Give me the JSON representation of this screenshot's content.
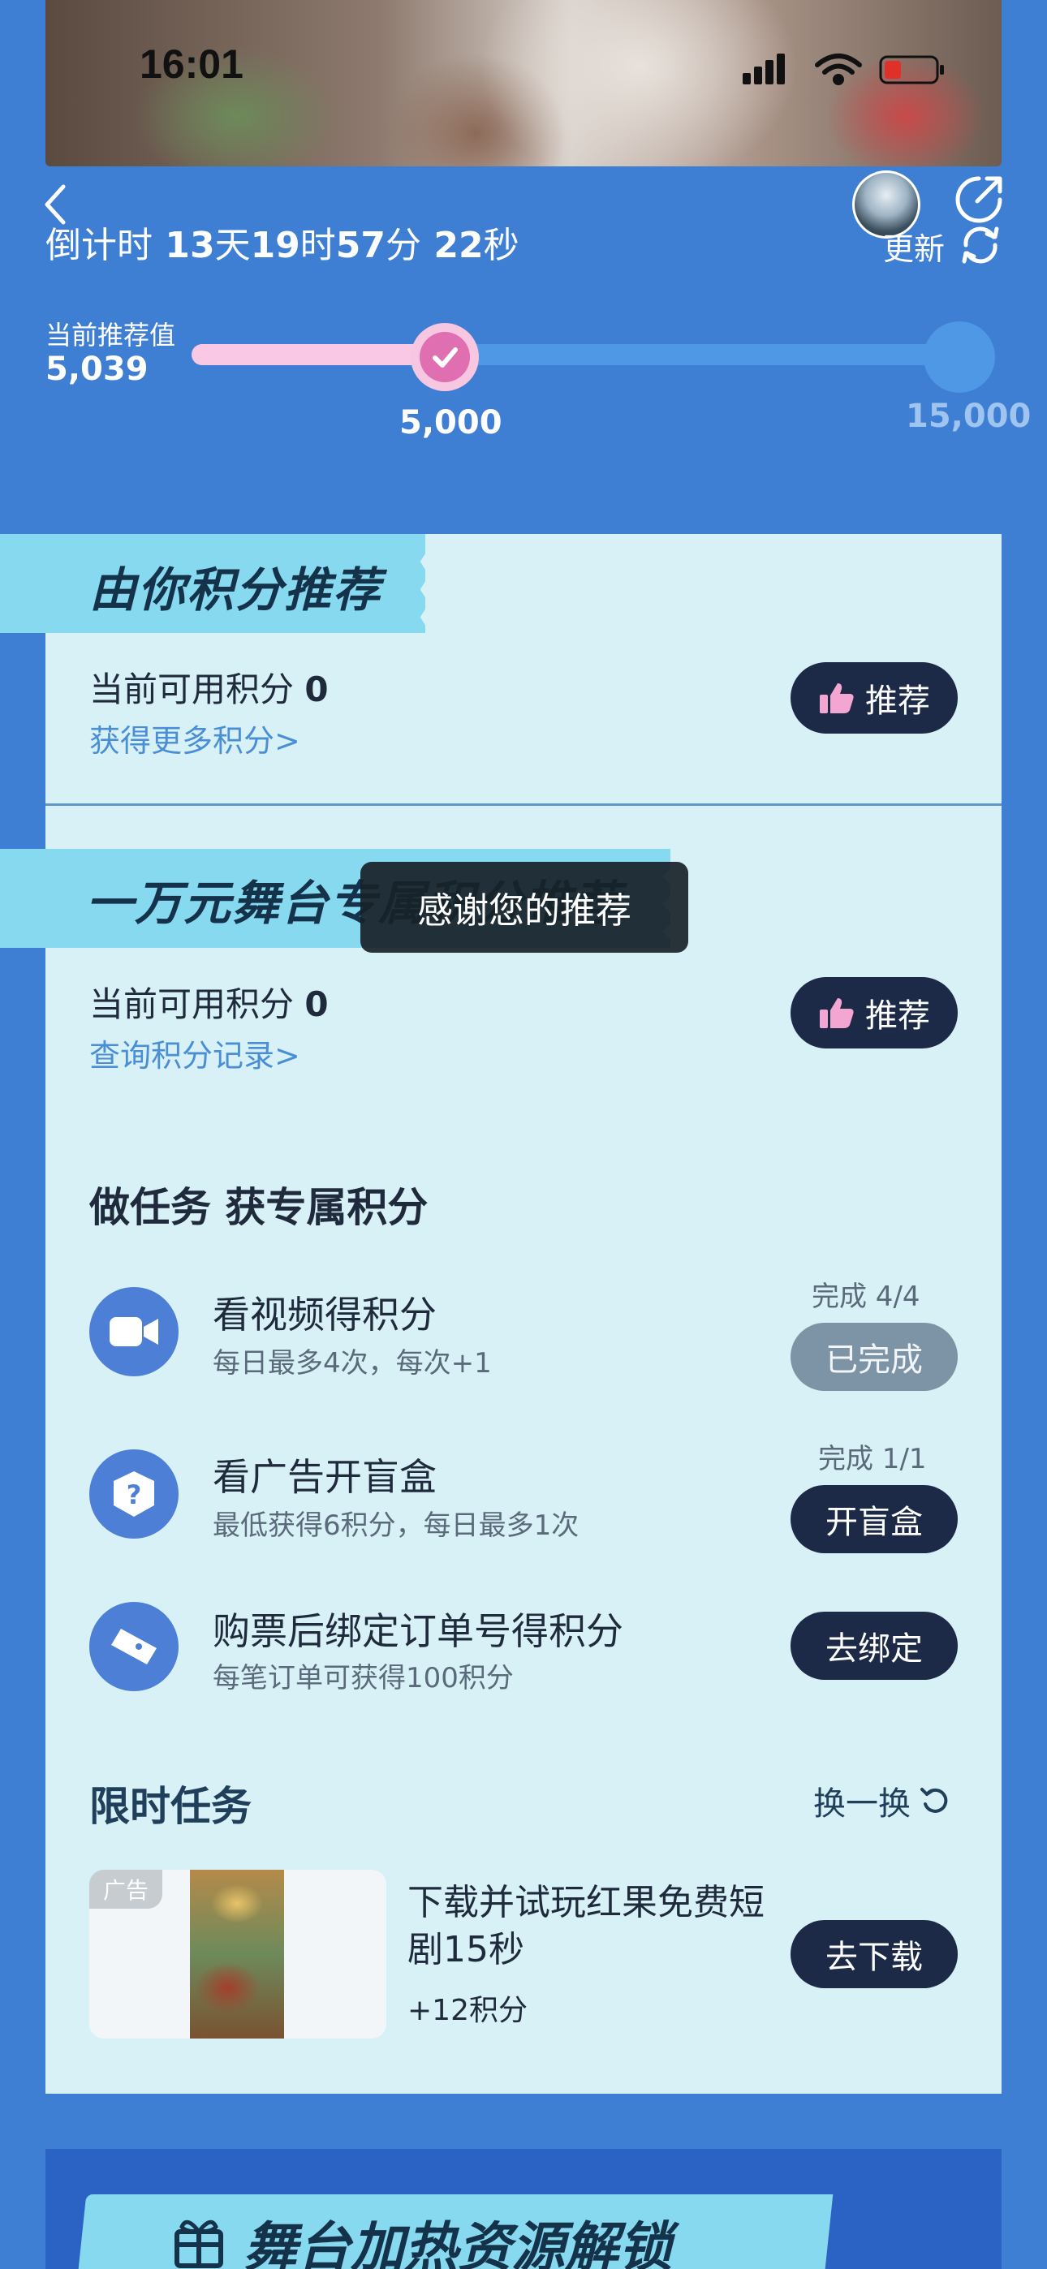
{
  "status_bar": {
    "time": "16:01"
  },
  "header": {
    "countdown": {
      "prefix": "倒计时",
      "days": "13",
      "days_unit": "天",
      "hours": "19",
      "hours_unit": "时",
      "minutes": "57",
      "minutes_unit": "分",
      "seconds": "22",
      "seconds_unit": "秒"
    },
    "refresh_label": "更新"
  },
  "recommend": {
    "label": "当前推荐值",
    "value": "5,039",
    "progress_fraction": 0.335,
    "milestones": [
      "5,000",
      "15,000"
    ]
  },
  "section_points": {
    "title": "由你积分推荐",
    "points_label": "当前可用积分",
    "points_value": "0",
    "link": "获得更多积分>",
    "button": "推荐"
  },
  "section_stage": {
    "title": "一万元舞台专属积分推荐",
    "points_label": "当前可用积分",
    "points_value": "0",
    "link": "查询积分记录>",
    "button": "推荐"
  },
  "toast": "感谢您的推荐",
  "tasks": {
    "title": "做任务 获专属积分",
    "items": [
      {
        "icon": "video-camera-icon",
        "name": "看视频得积分",
        "desc": "每日最多4次，每次+1",
        "progress": "完成 4/4",
        "button": "已完成",
        "done": true
      },
      {
        "icon": "question-box-icon",
        "name": "看广告开盲盒",
        "desc": "最低获得6积分，每日最多1次",
        "progress": "完成 1/1",
        "button": "开盲盒",
        "done": false
      },
      {
        "icon": "ticket-icon",
        "name": "购票后绑定订单号得积分",
        "desc": "每笔订单可获得100积分",
        "progress": "",
        "button": "去绑定",
        "done": false
      }
    ]
  },
  "limited": {
    "title": "限时任务",
    "refresh": "换一换",
    "ad": {
      "tag": "广告",
      "name": "下载并试玩红果免费短剧15秒",
      "reward": "+12积分",
      "button": "去下载"
    }
  },
  "bottom_banner": {
    "title": "舞台加热资源解锁"
  },
  "colors": {
    "background": "#3f7fd3",
    "card": "#d8f1f6",
    "ribbon": "#87d9f0",
    "dark_button": "#1c2a48",
    "done_button": "#7d93a6",
    "pink": "#f9c8e4"
  }
}
